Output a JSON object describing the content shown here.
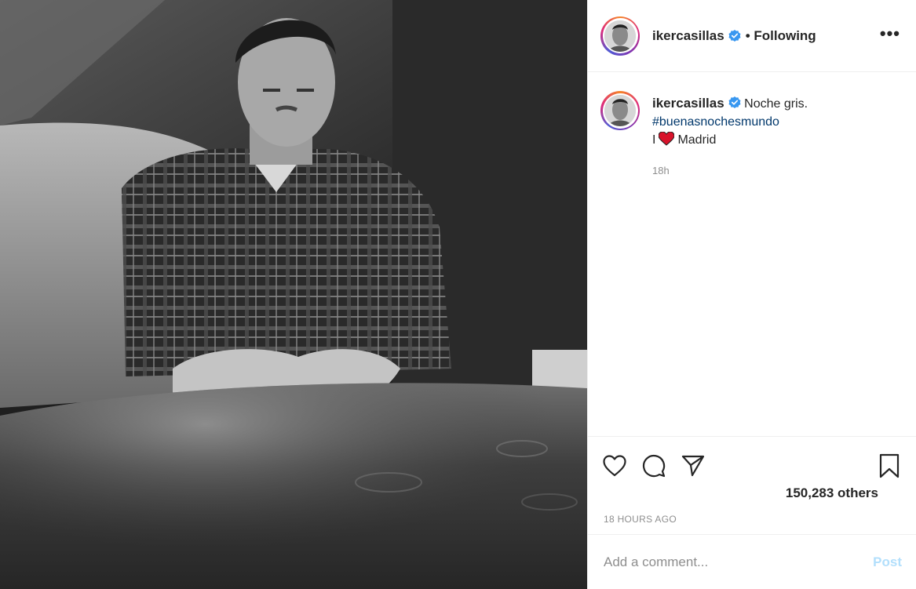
{
  "post": {
    "image_alt": "Black and white photo of a man in a plaid shirt sitting at a table"
  },
  "header": {
    "username": "ikercasillas",
    "verified_icon": "verified-badge-icon",
    "follow_state": "• Following",
    "more_icon": "more-options-icon",
    "more_label": "•••"
  },
  "caption": {
    "username": "ikercasillas",
    "text": "Noche gris.",
    "hashtag": "#buenasnochesmundo",
    "line3_prefix": "I",
    "line3_suffix": "Madrid",
    "emoji": "red-heart-icon",
    "time": "18h"
  },
  "actions": {
    "like_icon": "heart-icon",
    "comment_icon": "comment-icon",
    "share_icon": "paper-plane-icon",
    "save_icon": "bookmark-icon"
  },
  "likes": "150,283 others",
  "timestamp": "18 HOURS AGO",
  "comment_box": {
    "placeholder": "Add a comment...",
    "post_label": "Post"
  },
  "colors": {
    "verified": "#3897f0",
    "hashtag": "#00376b",
    "post_disabled": "#b2dffc",
    "muted": "#8e8e8e"
  }
}
